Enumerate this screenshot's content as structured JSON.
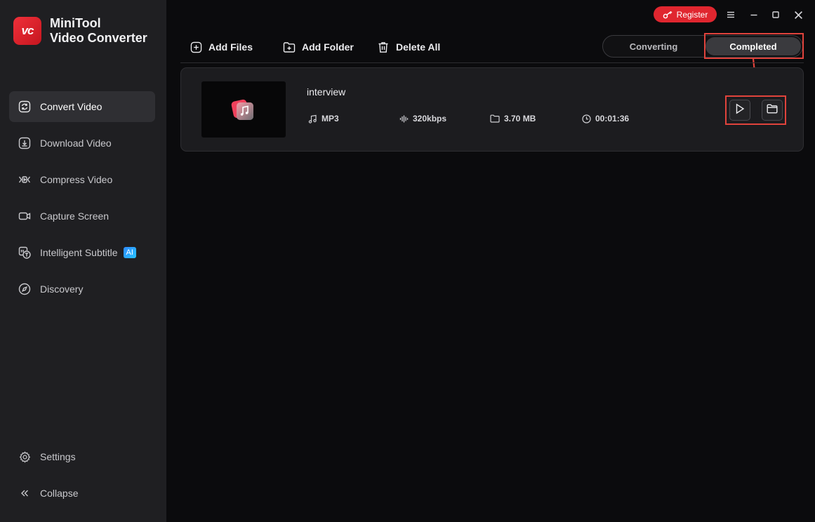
{
  "app": {
    "name_line1": "MiniTool",
    "name_line2": "Video Converter",
    "logo_text": "vc",
    "brand_color": "#e0262f"
  },
  "sidebar": {
    "items": [
      {
        "label": "Convert Video",
        "icon": "convert-icon",
        "active": true
      },
      {
        "label": "Download Video",
        "icon": "download-icon",
        "active": false
      },
      {
        "label": "Compress Video",
        "icon": "compress-icon",
        "active": false
      },
      {
        "label": "Capture Screen",
        "icon": "camera-icon",
        "active": false
      },
      {
        "label": "Intelligent Subtitle",
        "icon": "subtitle-icon",
        "active": false,
        "badge": "AI"
      },
      {
        "label": "Discovery",
        "icon": "compass-icon",
        "active": false
      }
    ],
    "settings_label": "Settings",
    "collapse_label": "Collapse"
  },
  "titlebar": {
    "register_label": "Register",
    "icons": [
      "menu-icon",
      "minimize-icon",
      "maximize-icon",
      "close-icon"
    ]
  },
  "toolbar": {
    "add_files": "Add Files",
    "add_folder": "Add Folder",
    "delete_all": "Delete All"
  },
  "tabs": {
    "converting": "Converting",
    "completed": "Completed",
    "selected": "Completed"
  },
  "files": [
    {
      "name": "interview",
      "format": "MP3",
      "bitrate": "320kbps",
      "size": "3.70 MB",
      "duration": "00:01:36",
      "actions": [
        "play-icon",
        "folder-icon"
      ]
    }
  ],
  "highlight_color": "#e0433c"
}
